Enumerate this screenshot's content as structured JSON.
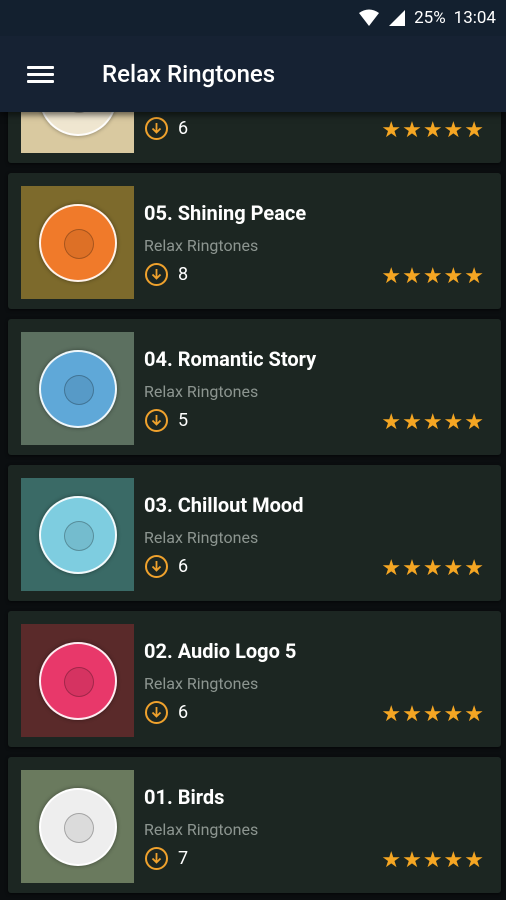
{
  "status": {
    "battery": "25%",
    "time": "13:04"
  },
  "appbar": {
    "title": "Relax Ringtones"
  },
  "cards": [
    {
      "title": "",
      "artist": "",
      "downloads": "6",
      "rating": 5,
      "thumb_bg": "#d9c9a0",
      "disc_color": "#efe6d0"
    },
    {
      "title": "05. Shining Peace",
      "artist": "Relax Ringtones",
      "downloads": "8",
      "rating": 5,
      "thumb_bg": "#7d6a2c",
      "disc_color": "#f07a2a"
    },
    {
      "title": "04. Romantic Story",
      "artist": "Relax Ringtones",
      "downloads": "5",
      "rating": 5,
      "thumb_bg": "#5c7060",
      "disc_color": "#5fa8d8"
    },
    {
      "title": "03. Chillout Mood",
      "artist": "Relax Ringtones",
      "downloads": "6",
      "rating": 5,
      "thumb_bg": "#3a6a66",
      "disc_color": "#7ecde0"
    },
    {
      "title": "02. Audio Logo 5",
      "artist": "Relax Ringtones",
      "downloads": "6",
      "rating": 5,
      "thumb_bg": "#5a2a2a",
      "disc_color": "#e8386a"
    },
    {
      "title": "01. Birds",
      "artist": "Relax Ringtones",
      "downloads": "7",
      "rating": 5,
      "thumb_bg": "#6a7a5e",
      "disc_color": "#eeeeee"
    }
  ],
  "colors": {
    "accent": "#f5a623",
    "card": "#1c2622",
    "appbar": "#162233"
  }
}
